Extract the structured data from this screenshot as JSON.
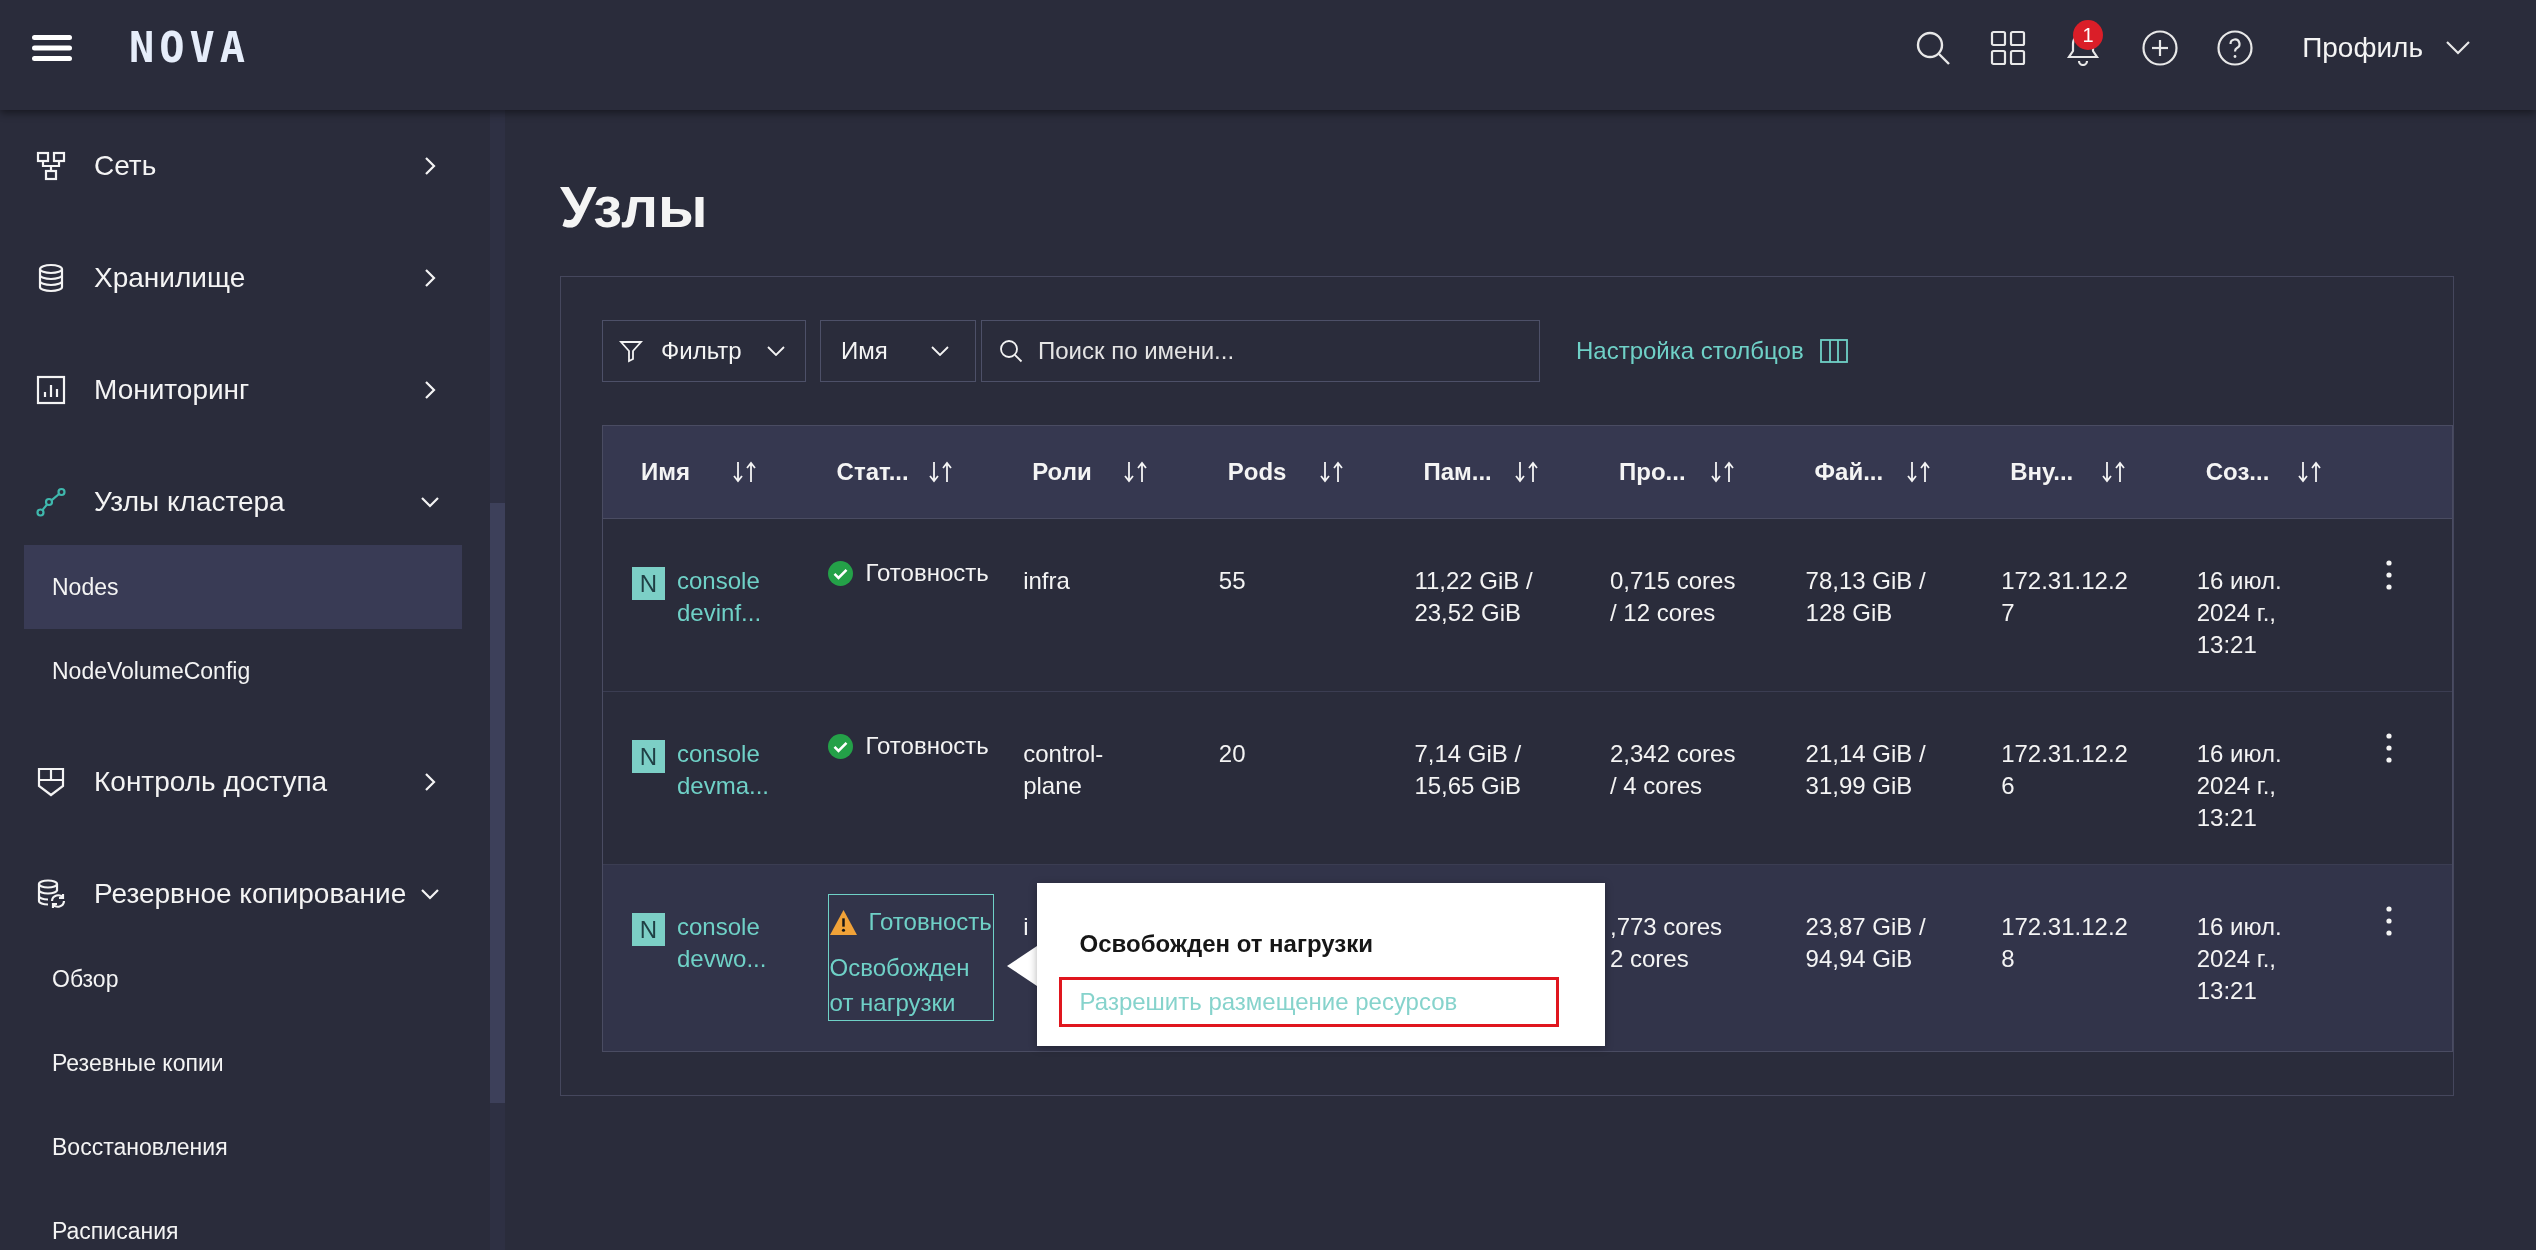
{
  "header": {
    "logo": "NOVA",
    "notification_count": "1",
    "profile": "Профиль"
  },
  "sidebar": {
    "items": [
      {
        "label": "Сеть",
        "expanded": false
      },
      {
        "label": "Хранилище",
        "expanded": false
      },
      {
        "label": "Мониторинг",
        "expanded": false
      },
      {
        "label": "Узлы кластера",
        "expanded": true,
        "children": [
          {
            "label": "Nodes",
            "selected": true
          },
          {
            "label": "NodeVolumeConfig",
            "selected": false
          }
        ]
      },
      {
        "label": "Контроль доступа",
        "expanded": false
      },
      {
        "label": "Резервное копирование",
        "expanded": true,
        "children": [
          {
            "label": "Обзор",
            "selected": false
          },
          {
            "label": "Резевные копии",
            "selected": false
          },
          {
            "label": "Восстановления",
            "selected": false
          },
          {
            "label": "Расписания",
            "selected": false
          }
        ]
      }
    ]
  },
  "page": {
    "title": "Узлы"
  },
  "toolbar": {
    "filter": "Фильтр",
    "field": "Имя",
    "search": {
      "placeholder": "Поиск по имени..."
    },
    "columns_link": "Настройка столбцов"
  },
  "table": {
    "columns": [
      "Имя",
      "Стат...",
      "Роли",
      "Pods",
      "Пам...",
      "Про...",
      "Фай...",
      "Вну...",
      "Соз..."
    ],
    "rows": [
      {
        "hovered": false,
        "cells": {
          "name": {
            "badge": "N",
            "text": "console\ndevinf..."
          },
          "column_2": {
            "kind": "ready",
            "label": "Готовность"
          },
          "roles": "infra",
          "pods": "55",
          "column_5": "11,22 GiB /\n23,52 GiB",
          "column_6": "0,715 cores\n/ 12 cores",
          "column_7": "78,13 GiB /\n128 GiB",
          "column_8": "172.31.12.2\n7",
          "column_9": "16 июл.\n2024 г.,\n13:21"
        }
      },
      {
        "hovered": false,
        "cells": {
          "name": {
            "badge": "N",
            "text": "console\ndevma..."
          },
          "column_2": {
            "kind": "ready",
            "label": "Готовность"
          },
          "roles": "control-\nplane",
          "pods": "20",
          "column_5": "7,14 GiB /\n15,65 GiB",
          "column_6": "2,342 cores\n/ 4 cores",
          "column_7": "21,14 GiB /\n31,99 GiB",
          "column_8": "172.31.12.2\n6",
          "column_9": "16 июл.\n2024 г.,\n13:21"
        }
      },
      {
        "hovered": true,
        "cells": {
          "name": {
            "badge": "N",
            "text": "console\ndevwo..."
          },
          "column_2": {
            "kind": "warning",
            "label": "Готовность",
            "detail": "Освобожден\nот нагрузки",
            "expanded": true,
            "popover": {
              "title": "Освобожден от нагрузки",
              "action": {
                "label": "Разрешить размещение ресурсов",
                "highlighted": true
              }
            }
          },
          "roles": "i",
          "column_6": ",773 cores\n2 cores",
          "column_7": "23,87 GiB /\n94,94 GiB",
          "column_8": "172.31.12.2\n8",
          "column_9": "16 июл.\n2024 г.,\n13:21"
        }
      }
    ]
  }
}
